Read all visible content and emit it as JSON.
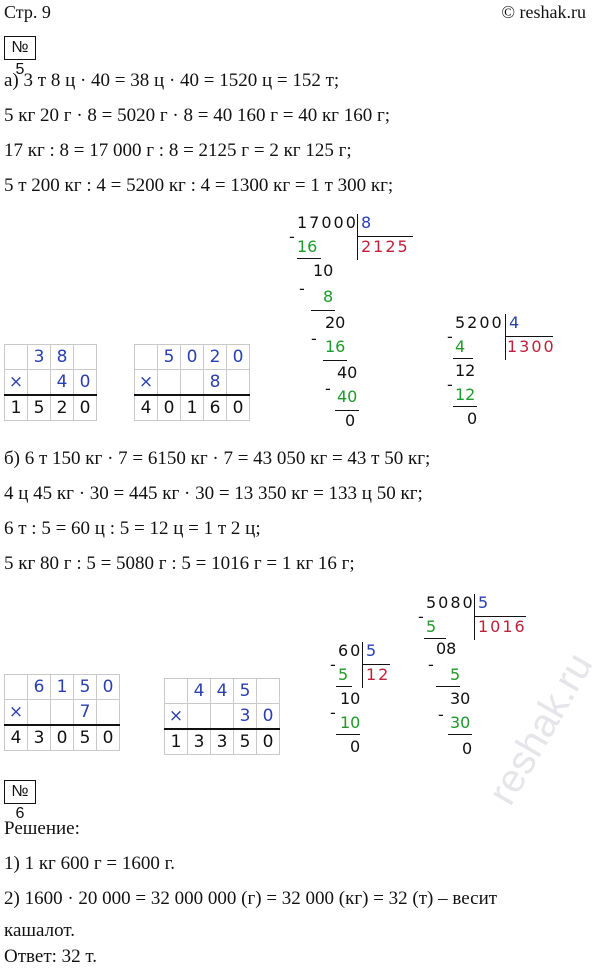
{
  "header": {
    "page": "Стр. 9",
    "site": "© reshak.ru"
  },
  "task5": {
    "label": "№ 5",
    "a_lines": [
      "а) 3 т 8 ц · 40 = 38 ц · 40 = 1520 ц = 152 т;",
      "5 кг 20 г · 8 = 5020 г · 8 = 40 160 г = 40 кг 160 г;",
      "17 кг : 8 = 17 000 г : 8 = 2125 г = 2 кг 125 г;",
      "5 т 200 кг : 4 = 5200 кг : 4 = 1300 кг = 1 т 300 кг;"
    ],
    "b_lines": [
      "б) 6 т 150 кг · 7 = 6150 кг · 7 = 43 050 кг = 43 т 50 кг;",
      "4 ц 45 кг · 30 = 445 кг · 30 = 13 350 кг = 133 ц 50 кг;",
      "6 т : 5 = 60 ц : 5 = 12 ц = 1 т 2 ц;",
      "5 кг 80 г : 5 = 5080 г : 5 = 1016 г = 1 кг 16 г;"
    ],
    "mult1": {
      "op": "×",
      "top": [
        "3",
        "8",
        ""
      ],
      "mid": [
        "",
        "4",
        "0"
      ],
      "res": [
        "1",
        "5",
        "2",
        "0"
      ]
    },
    "mult2": {
      "op": "×",
      "top": [
        "5",
        "0",
        "2",
        "0"
      ],
      "mid": [
        "",
        "",
        "8",
        ""
      ],
      "res": [
        "4",
        "0",
        "1",
        "6",
        "0"
      ]
    },
    "mult3": {
      "op": "×",
      "top": [
        "6",
        "1",
        "5",
        "0"
      ],
      "mid": [
        "",
        "",
        "7",
        ""
      ],
      "res": [
        "4",
        "3",
        "0",
        "5",
        "0"
      ]
    },
    "mult4": {
      "op": "×",
      "top": [
        "4",
        "4",
        "5"
      ],
      "mid": [
        "",
        "3",
        "0"
      ],
      "res": [
        "1",
        "3",
        "3",
        "5",
        "0"
      ]
    },
    "div1": {
      "dividend": "17000",
      "divisor": "8",
      "quotient": "2125",
      "steps": [
        "16",
        "10",
        "8",
        "20",
        "16",
        "40",
        "40",
        "0"
      ]
    },
    "div2": {
      "dividend": "5200",
      "divisor": "4",
      "quotient": "1300",
      "steps": [
        "4",
        "12",
        "12",
        "0"
      ]
    },
    "div3": {
      "dividend": "60",
      "divisor": "5",
      "quotient": "12",
      "steps": [
        "5",
        "10",
        "10",
        "0"
      ]
    },
    "div4": {
      "dividend": "5080",
      "divisor": "5",
      "quotient": "1016",
      "steps": [
        "5",
        "08",
        "5",
        "30",
        "30",
        "0"
      ]
    }
  },
  "task6": {
    "label": "№ 6",
    "heading": "Решение:",
    "lines": [
      "1) 1 кг 600 г = 1600 г.",
      "2) 1600 · 20 000 = 32 000 000 (г) = 32 000 (кг) = 32 (т) – весит",
      "кашалот."
    ],
    "answer": "Ответ: 32 т."
  },
  "watermark": "reshak.ru"
}
